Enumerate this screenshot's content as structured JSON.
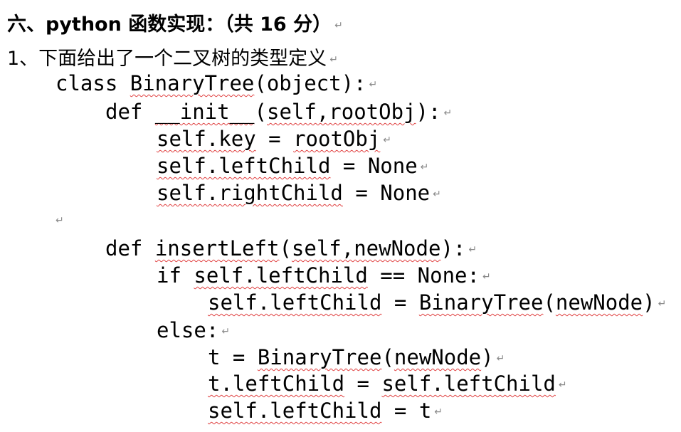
{
  "heading": {
    "text": "六、python 函数实现：（共 16 分）",
    "mark": "↵"
  },
  "question": {
    "text": "1、下面给出了一个二叉树的类型定义",
    "mark": "↵"
  },
  "paragraph_mark": "↵",
  "code": {
    "l1": {
      "a": "class ",
      "b": "BinaryTree",
      "c": "(object):"
    },
    "l2": {
      "a": "def ",
      "b": "__init__",
      "c": "(",
      "d": "self,rootObj",
      "e": "):"
    },
    "l3": {
      "a": "self.key",
      "b": " = ",
      "c": "rootObj"
    },
    "l4": {
      "a": "self.leftChild",
      "b": " = None"
    },
    "l5": {
      "a": "self.rightChild",
      "b": " = None"
    },
    "l6": {
      "a": "def ",
      "b": "insertLeft",
      "c": "(",
      "d": "self,newNode",
      "e": "):"
    },
    "l7": {
      "a": "if ",
      "b": "self.leftChild",
      "c": " == None:"
    },
    "l8": {
      "a": "self.leftChild",
      "b": " = ",
      "c": "BinaryTree",
      "d": "(",
      "e": "newNode",
      "f": ")"
    },
    "l9": {
      "a": "else:"
    },
    "l10": {
      "a": "t = ",
      "b": "BinaryTree",
      "c": "(",
      "d": "newNode",
      "e": ")"
    },
    "l11": {
      "a": "t.leftChild",
      "b": " = ",
      "c": "self.leftChild"
    },
    "l12": {
      "a": "self.leftChild",
      "b": " = t"
    }
  }
}
